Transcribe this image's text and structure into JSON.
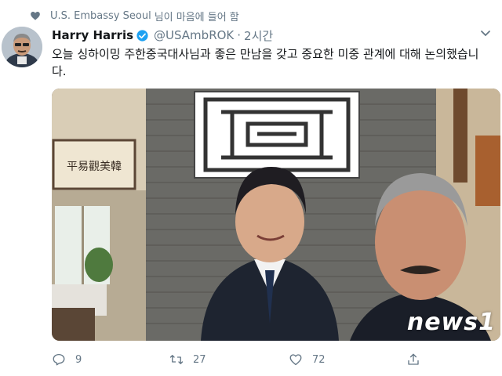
{
  "liked_by": {
    "name": "U.S. Embassy Seoul",
    "suffix": "님이 마음에 들어 함",
    "icon": "heart-icon"
  },
  "tweet": {
    "author": {
      "display_name": "Harry Harris",
      "verified": true,
      "handle": "@USAmbROK",
      "separator": "·",
      "time": "2시간"
    },
    "text": "오늘 싱하이밍 주한중국대사님과 좋은 만남을 갖고 중요한 미중 관계에 대해 논의했습니다.",
    "media": {
      "calligraphy": "平易觀美韓",
      "watermark": "news1"
    },
    "actions": {
      "replies": "9",
      "retweets": "27",
      "likes": "72"
    }
  },
  "colors": {
    "verified": "#1da1f2",
    "muted": "#657786",
    "text": "#14171a"
  }
}
